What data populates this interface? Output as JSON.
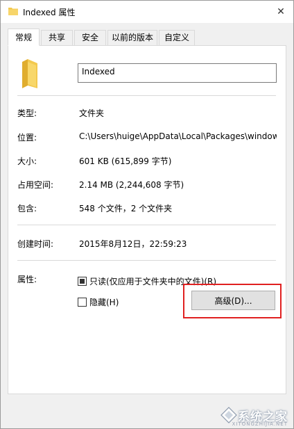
{
  "window": {
    "title": "Indexed 属性",
    "close_glyph": "✕"
  },
  "tabs": [
    {
      "label": "常规",
      "active": true
    },
    {
      "label": "共享",
      "active": false
    },
    {
      "label": "安全",
      "active": false
    },
    {
      "label": "以前的版本",
      "active": false
    },
    {
      "label": "自定义",
      "active": false
    }
  ],
  "general": {
    "name_value": "Indexed",
    "rows": [
      {
        "label": "类型:",
        "value": "文件夹"
      },
      {
        "label": "位置:",
        "value": "C:\\Users\\huige\\AppData\\Local\\Packages\\windows"
      },
      {
        "label": "大小:",
        "value": "601 KB (615,899 字节)"
      },
      {
        "label": "占用空间:",
        "value": "2.14 MB (2,244,608 字节)"
      },
      {
        "label": "包含:",
        "value": "548 个文件，2 个文件夹"
      },
      {
        "label": "创建时间:",
        "value": "2015年8月12日，22:59:23"
      }
    ],
    "attributes_label": "属性:",
    "readonly_label": "只读(仅应用于文件夹中的文件)(R)",
    "readonly_state": "indeterminate",
    "hidden_label": "隐藏(H)",
    "hidden_state": "unchecked",
    "advanced_button": "高级(D)..."
  },
  "colors": {
    "folder": "#f3c94e",
    "highlight": "#e02020"
  },
  "watermark": {
    "text": "系统之家",
    "sub": "XITONGZHIJIA.NET"
  }
}
